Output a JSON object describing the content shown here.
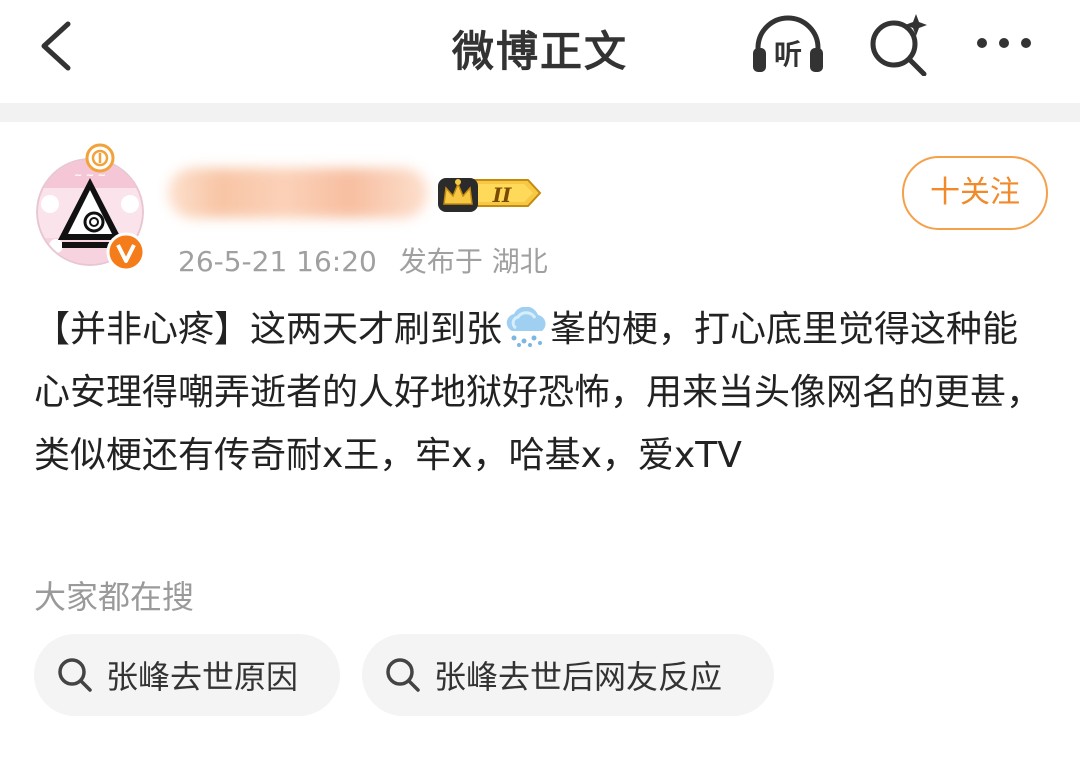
{
  "header": {
    "title": "微博正文",
    "back_icon": "chevron-left-icon",
    "listen_label": "听",
    "search_icon": "search-sparkle-icon",
    "more_icon": "more-dots-icon"
  },
  "post": {
    "level_text": "II",
    "timestamp": "26-5-21 16:20",
    "location": "发布于 湖北",
    "follow_label": "十关注",
    "content_part1": "【并非心疼】这两天才刷到张",
    "content_emoji": "snow-cloud-icon",
    "content_part2": "峯的梗，打心底里觉得这种能心安理得嘲弄逝者的人好地狱好恐怖，用来当头像网名的更甚，类似梗还有传奇耐x王，牢x，哈基x，爱xTV"
  },
  "related": {
    "label": "大家都在搜",
    "chips": [
      {
        "label": "张峰去世原因"
      },
      {
        "label": "张峰去世后网友反应"
      }
    ]
  },
  "colors": {
    "accent": "#f08a2a",
    "divider": "#f2f2f2",
    "chip_bg": "#f4f4f4",
    "meta_text": "#a0a0a0"
  }
}
